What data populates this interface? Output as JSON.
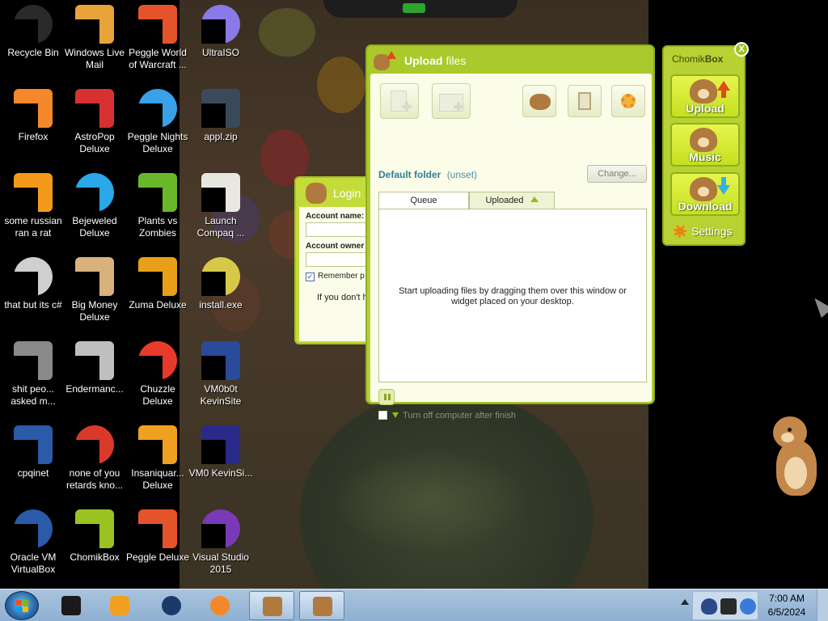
{
  "desktop": {
    "icons": [
      {
        "label": "Recycle Bin",
        "icon": "recycle-bin-icon",
        "color": "#2a2a2a"
      },
      {
        "label": "Windows Live Mail",
        "icon": "mail-icon",
        "color": "#e8a33a"
      },
      {
        "label": "Peggle World of Warcraft ...",
        "icon": "peggle-icon",
        "color": "#e4532a"
      },
      {
        "label": "UltraISO",
        "icon": "disc-icon",
        "color": "#8a7ae8"
      },
      {
        "label": "Firefox",
        "icon": "firefox-icon",
        "color": "#f4882a"
      },
      {
        "label": "AstroPop Deluxe",
        "icon": "astropop-icon",
        "color": "#d83030"
      },
      {
        "label": "Peggle Nights Deluxe",
        "icon": "peggle-nights-icon",
        "color": "#3aa0e8"
      },
      {
        "label": "appl.zip",
        "icon": "zip-archive-icon",
        "color": "#3a4a5a"
      },
      {
        "label": "some russian ran a rat",
        "icon": "file-e-icon",
        "color": "#f49a1a"
      },
      {
        "label": "Bejeweled Deluxe",
        "icon": "bejeweled-icon",
        "color": "#2aa8e8"
      },
      {
        "label": "Plants vs Zombies",
        "icon": "plants-vs-zombies-icon",
        "color": "#6ab82a"
      },
      {
        "label": "Launch Compaq ...",
        "icon": "compaq-icon",
        "color": "#e8e8e0"
      },
      {
        "label": "that but its c#",
        "icon": "shortcut-icon",
        "color": "#cfcfcf"
      },
      {
        "label": "Big Money Deluxe",
        "icon": "big-money-icon",
        "color": "#d8b27a"
      },
      {
        "label": "Zuma Deluxe",
        "icon": "zuma-icon",
        "color": "#e8a01a"
      },
      {
        "label": "install.exe",
        "icon": "installer-icon",
        "color": "#d8c84a"
      },
      {
        "label": "shit peo... asked m...",
        "icon": "folder-icon",
        "color": "#8a8a8a"
      },
      {
        "label": "Endermanc...",
        "icon": "window-icon",
        "color": "#bfbfbf"
      },
      {
        "label": "Chuzzle Deluxe",
        "icon": "chuzzle-icon",
        "color": "#e83a2a"
      },
      {
        "label": "VM0b0t KevinSite",
        "icon": "vm-icon",
        "color": "#2a4a9a"
      },
      {
        "label": "cpqinet",
        "icon": "cpqinet-icon",
        "color": "#2a5aa8"
      },
      {
        "label": "none of you retards kno...",
        "icon": "chrome-icon",
        "color": "#d83a2a"
      },
      {
        "label": "Insaniquar... Deluxe",
        "icon": "fish-icon",
        "color": "#f0a020"
      },
      {
        "label": "VM0 KevinSi...",
        "icon": "vm-file-icon",
        "color": "#2a2a8a"
      },
      {
        "label": "Oracle VM VirtualBox",
        "icon": "virtualbox-icon",
        "color": "#2a5aa8"
      },
      {
        "label": "ChomikBox",
        "icon": "chomikbox-icon",
        "color": "#9ac220"
      },
      {
        "label": "Peggle Deluxe",
        "icon": "peggle-deluxe-icon",
        "color": "#e4532a"
      },
      {
        "label": "Visual Studio 2015",
        "icon": "visual-studio-icon",
        "color": "#7a3ab8"
      }
    ]
  },
  "widget": {
    "title_plain": "Chomik",
    "title_bold": "Box",
    "close": "X",
    "buttons": [
      {
        "label": "Upload",
        "icon": "upload-arrow-icon"
      },
      {
        "label": "Music",
        "icon": "headphones-hamster-icon"
      },
      {
        "label": "Download",
        "icon": "download-arrow-icon"
      }
    ],
    "settings_label": "Settings",
    "accent": "#b7d232"
  },
  "login": {
    "title": "Login",
    "account_name_label": "Account name:",
    "account_owner_label_plain": "Account",
    "account_owner_label_bold": "owner",
    "remember_label": "Remember p",
    "hint": "If you don't h"
  },
  "upload_window": {
    "title_bold": "Upload",
    "title_rest": "files",
    "toolbar": {
      "add_file": "add-file-icon",
      "add_folder": "add-folder-icon",
      "hamster": "hamster-icon",
      "clipboard": "clipboard-add-icon",
      "settings": "gear-icon"
    },
    "default_folder_label": "Default folder",
    "default_folder_value": "(unset)",
    "change_button": "Change...",
    "tabs": [
      {
        "label": "Queue"
      },
      {
        "label": "Uploaded"
      }
    ],
    "queue_message": "Start uploading files by dragging them over this window or widget placed on your desktop.",
    "turn_off_label": "Turn off computer after finish"
  },
  "taskbar": {
    "apps": [
      {
        "name": "start-menu",
        "icon": "windows-logo-icon"
      },
      {
        "name": "app-terminal",
        "icon": "terminal-icon",
        "color": "#1a1a1a"
      },
      {
        "name": "app-media-player",
        "icon": "media-player-icon",
        "color": "#f0a020"
      },
      {
        "name": "app-ball",
        "icon": "sphere-icon",
        "color": "#1a3a6a"
      },
      {
        "name": "app-firefox",
        "icon": "firefox-icon",
        "color": "#f4882a"
      },
      {
        "name": "app-chomikbox",
        "icon": "chomikbox-icon",
        "color": "#b07a3e"
      },
      {
        "name": "app-chomik-upload",
        "icon": "chomik-upload-icon",
        "color": "#b07a3e"
      }
    ],
    "time": "7:00 AM",
    "date": "6/5/2024"
  }
}
